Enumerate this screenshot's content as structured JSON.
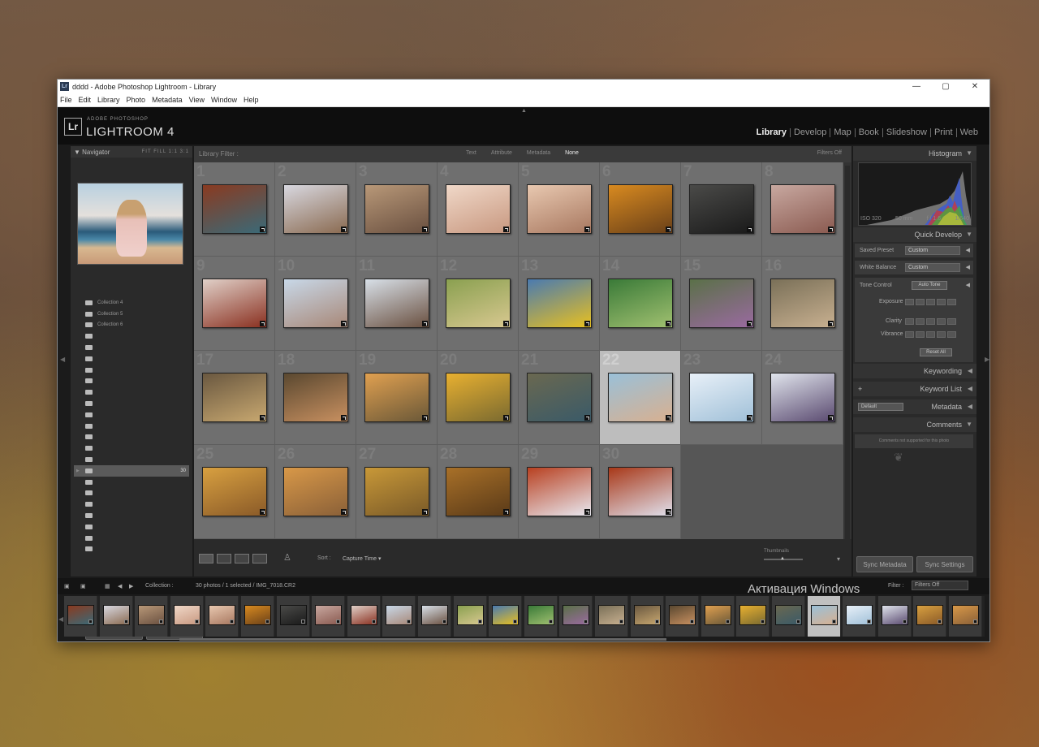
{
  "window": {
    "title": "dddd - Adobe Photoshop Lightroom - Library",
    "app_icon": "Lr",
    "controls": [
      "—",
      "▢",
      "✕"
    ]
  },
  "menu": [
    "File",
    "Edit",
    "Library",
    "Photo",
    "Metadata",
    "View",
    "Window",
    "Help"
  ],
  "identity": {
    "logo": "Lr",
    "brand_top": "ADOBE PHOTOSHOP",
    "brand_main": "LIGHTROOM 4"
  },
  "modules": [
    {
      "label": "Library",
      "active": true
    },
    {
      "label": "Develop",
      "active": false
    },
    {
      "label": "Map",
      "active": false
    },
    {
      "label": "Book",
      "active": false
    },
    {
      "label": "Slideshow",
      "active": false
    },
    {
      "label": "Print",
      "active": false
    },
    {
      "label": "Web",
      "active": false
    }
  ],
  "navigator": {
    "title": "Navigator",
    "zoom_options": "FIT  FILL  1:1  3:1"
  },
  "collections": [
    {
      "name": "Collection 4",
      "count": "",
      "selected": false
    },
    {
      "name": "Collection 5",
      "count": "",
      "selected": false
    },
    {
      "name": "Collection 6",
      "count": "",
      "selected": false
    },
    {
      "name": "",
      "count": "",
      "selected": false
    },
    {
      "name": "",
      "count": "",
      "selected": false
    },
    {
      "name": "",
      "count": "",
      "selected": false
    },
    {
      "name": "",
      "count": "",
      "selected": false
    },
    {
      "name": "",
      "count": "",
      "selected": false
    },
    {
      "name": "",
      "count": "",
      "selected": false
    },
    {
      "name": "",
      "count": "",
      "selected": false
    },
    {
      "name": "",
      "count": "",
      "selected": false
    },
    {
      "name": "",
      "count": "",
      "selected": false
    },
    {
      "name": "",
      "count": "",
      "selected": false
    },
    {
      "name": "",
      "count": "",
      "selected": false
    },
    {
      "name": "",
      "count": "",
      "selected": false
    },
    {
      "name": "",
      "count": "30",
      "selected": true
    },
    {
      "name": "",
      "count": "",
      "selected": false
    },
    {
      "name": "",
      "count": "",
      "selected": false
    },
    {
      "name": "",
      "count": "",
      "selected": false
    },
    {
      "name": "",
      "count": "",
      "selected": false
    },
    {
      "name": "",
      "count": "",
      "selected": false
    },
    {
      "name": "",
      "count": "",
      "selected": false
    },
    {
      "name": "",
      "count": "",
      "selected": false
    }
  ],
  "left_buttons": {
    "import": "Import...",
    "export": "Export..."
  },
  "filter_bar": {
    "label": "Library Filter :",
    "options": [
      {
        "label": "Text",
        "active": false
      },
      {
        "label": "Attribute",
        "active": false
      },
      {
        "label": "Metadata",
        "active": false
      },
      {
        "label": "None",
        "active": true
      }
    ],
    "right": "Filters Off"
  },
  "grid": {
    "columns": 8,
    "selected_index": 22,
    "photos": [
      {
        "n": "1",
        "c1": "#8a3a20",
        "c2": "#3a6a78"
      },
      {
        "n": "2",
        "c1": "#d8d8e0",
        "c2": "#8a6a50"
      },
      {
        "n": "3",
        "c1": "#b89878",
        "c2": "#6a5040"
      },
      {
        "n": "4",
        "c1": "#f0d8c8",
        "c2": "#c89880"
      },
      {
        "n": "5",
        "c1": "#e8c8b0",
        "c2": "#a87860"
      },
      {
        "n": "6",
        "c1": "#d88a20",
        "c2": "#6a4018"
      },
      {
        "n": "7",
        "c1": "#4a4a48",
        "c2": "#1a1a1a"
      },
      {
        "n": "8",
        "c1": "#c8a8a0",
        "c2": "#8a5a50"
      },
      {
        "n": "9",
        "c1": "#e0d0c8",
        "c2": "#8a3020"
      },
      {
        "n": "10",
        "c1": "#c8d8e8",
        "c2": "#a88878"
      },
      {
        "n": "11",
        "c1": "#d8e0e8",
        "c2": "#6a5040"
      },
      {
        "n": "12",
        "c1": "#8aa050",
        "c2": "#d8c890"
      },
      {
        "n": "13",
        "c1": "#4a7ab0",
        "c2": "#e8c020"
      },
      {
        "n": "14",
        "c1": "#3a7a38",
        "c2": "#a0c070"
      },
      {
        "n": "15",
        "c1": "#5a7048",
        "c2": "#9a6aa0"
      },
      {
        "n": "16",
        "c1": "#7a7058",
        "c2": "#c8b090"
      },
      {
        "n": "17",
        "c1": "#6a5840",
        "c2": "#c8a870"
      },
      {
        "n": "18",
        "c1": "#5a4830",
        "c2": "#c89060"
      },
      {
        "n": "19",
        "c1": "#e0a050",
        "c2": "#6a5838"
      },
      {
        "n": "20",
        "c1": "#e8b030",
        "c2": "#7a6a30"
      },
      {
        "n": "21",
        "c1": "#6a6850",
        "c2": "#3a5a68"
      },
      {
        "n": "22",
        "c1": "#9ac0d8",
        "c2": "#d8b090"
      },
      {
        "n": "23",
        "c1": "#e8f0f8",
        "c2": "#a0c0d8"
      },
      {
        "n": "24",
        "c1": "#e0e4ec",
        "c2": "#5a4a70"
      },
      {
        "n": "25",
        "c1": "#d8a040",
        "c2": "#8a5a28"
      },
      {
        "n": "26",
        "c1": "#d89848",
        "c2": "#8a6038"
      },
      {
        "n": "27",
        "c1": "#c89838",
        "c2": "#7a5a28"
      },
      {
        "n": "28",
        "c1": "#a87028",
        "c2": "#5a3a18"
      },
      {
        "n": "29",
        "c1": "#b84020",
        "c2": "#e8e8f0"
      },
      {
        "n": "30",
        "c1": "#a83818",
        "c2": "#e0e0ec"
      }
    ]
  },
  "toolbar": {
    "sort_label": "Sort :",
    "sort_value": "Capture Time",
    "thumbnails_label": "Thumbnails"
  },
  "histogram": {
    "title": "Histogram",
    "info": [
      "ISO 320",
      "50 mm",
      "f / 1.6",
      "1/640"
    ]
  },
  "quick_develop": {
    "title": "Quick Develop",
    "saved_preset_label": "Saved Preset",
    "saved_preset_value": "Custom",
    "white_balance_label": "White Balance",
    "white_balance_value": "Custom",
    "tone_control_label": "Tone Control",
    "auto_tone": "Auto Tone",
    "exposure": "Exposure",
    "clarity": "Clarity",
    "vibrance": "Vibrance",
    "reset_all": "Reset All"
  },
  "right_sections": {
    "keywording": "Keywording",
    "keyword_list": "Keyword List",
    "metadata": "Metadata",
    "metadata_preset": "Default",
    "comments": "Comments",
    "comments_info": "Comments not supported for this photo"
  },
  "right_buttons": {
    "sync_metadata": "Sync Metadata",
    "sync_settings": "Sync Settings"
  },
  "filmstrip_bar": {
    "source": "Collection :",
    "info": "30 photos / 1 selected / IMG_7018.CR2",
    "filter_label": "Filter :",
    "filter_value": "Filters Off"
  },
  "overlay": {
    "activation": "Активация Windows"
  },
  "colors": {
    "accent": "#eeeeee",
    "panel": "#2a2a2a",
    "grid": "#6f6f6f",
    "selected": "#bdbdbd"
  }
}
